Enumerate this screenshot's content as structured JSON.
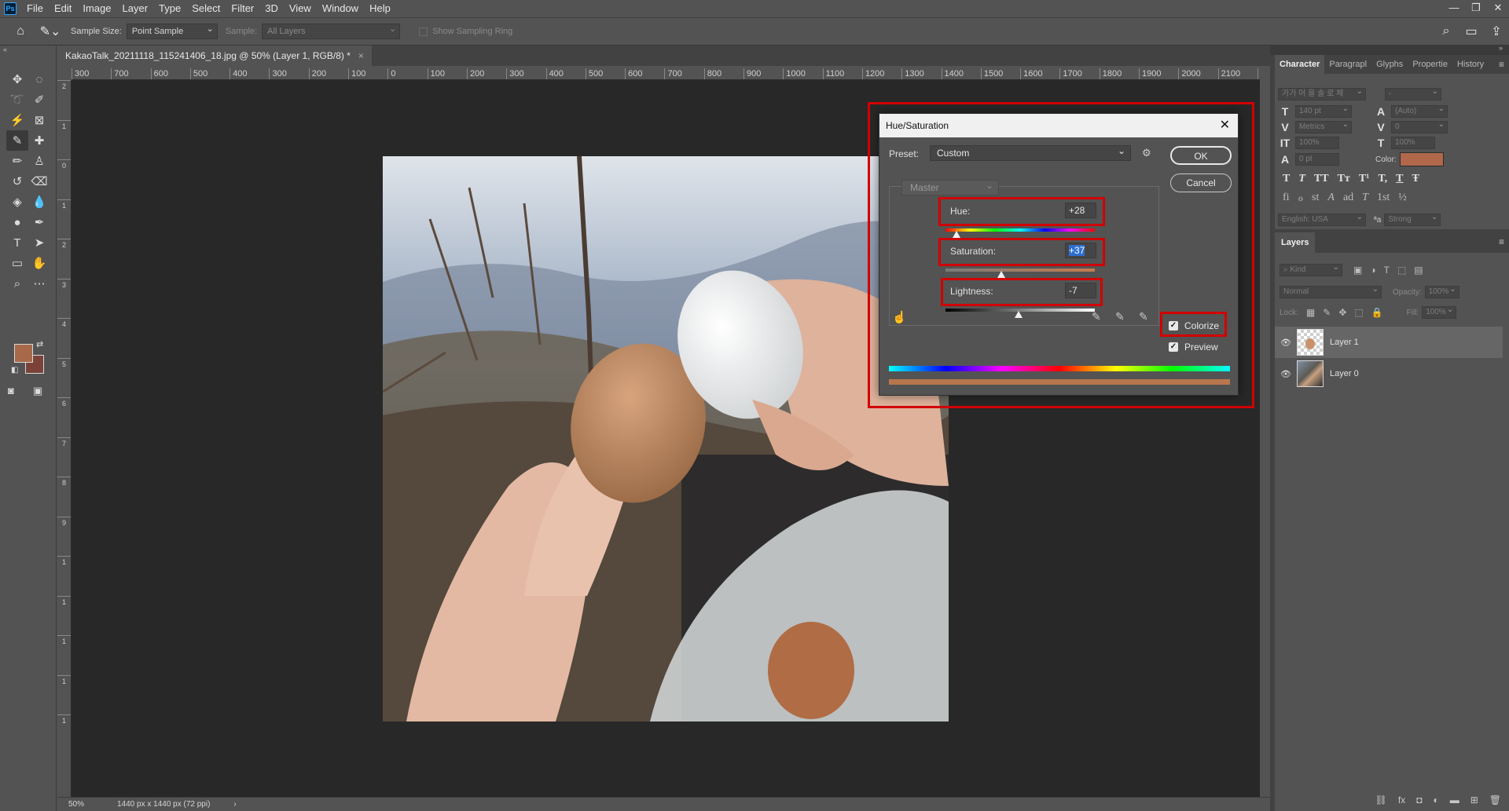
{
  "app": {
    "logo": "Ps",
    "menu": [
      "File",
      "Edit",
      "Image",
      "Layer",
      "Type",
      "Select",
      "Filter",
      "3D",
      "View",
      "Window",
      "Help"
    ],
    "window_controls": [
      "—",
      "❐",
      "✕"
    ]
  },
  "options_bar": {
    "sample_size_label": "Sample Size:",
    "sample_size_value": "Point Sample",
    "sample_label": "Sample:",
    "sample_value": "All Layers",
    "sampling_ring_label": "Show Sampling Ring"
  },
  "document": {
    "tab_title": "KakaoTalk_20211118_115241406_18.jpg @ 50% (Layer 1, RGB/8) *",
    "tab_close": "×",
    "ruler_h": [
      "300",
      "700",
      "600",
      "500",
      "400",
      "300",
      "200",
      "100",
      "0",
      "100",
      "200",
      "300",
      "400",
      "500",
      "600",
      "700",
      "800",
      "900",
      "1000",
      "1100",
      "1200",
      "1300",
      "1400",
      "1500",
      "1600",
      "1700",
      "1800",
      "1900",
      "2000",
      "2100",
      "22"
    ],
    "ruler_v": [
      "2",
      "1",
      "0",
      "1",
      "2",
      "3",
      "4",
      "5",
      "6",
      "7",
      "8",
      "9",
      "1",
      "1",
      "1",
      "1",
      "1"
    ],
    "zoom": "50%",
    "doc_info": "1440 px x 1440 px (72 ppi)",
    "status_arrow": "›"
  },
  "dialog": {
    "title": "Hue/Saturation",
    "close": "✕",
    "preset_label": "Preset:",
    "preset_value": "Custom",
    "ok": "OK",
    "cancel": "Cancel",
    "channel": "Master",
    "hue_label": "Hue:",
    "hue_value": "+28",
    "saturation_label": "Saturation:",
    "saturation_value": "+37",
    "lightness_label": "Lightness:",
    "lightness_value": "-7",
    "colorize_label": "Colorize",
    "colorize_checked": true,
    "preview_label": "Preview",
    "preview_checked": true,
    "highlight_color": "#d20000",
    "colorize_color": "#b9764d"
  },
  "character_panel": {
    "tabs": [
      "Character",
      "Paragrapl",
      "Glyphs",
      "Propertie",
      "History"
    ],
    "font_family": "가가 어 을 솔 로 체",
    "font_style": "-",
    "size": "140 pt",
    "leading": "(Auto)",
    "kerning": "Metrics",
    "tracking": "0",
    "vscale": "100%",
    "hscale": "100%",
    "baseline": "0 pt",
    "color_label": "Color:",
    "color": "#b0674a",
    "language": "English: USA",
    "aa_label": "ªa",
    "antialias": "Strong",
    "style_buttons": [
      "T",
      "T",
      "TT",
      "Tт",
      "T¹",
      "T,",
      "T",
      "Ŧ"
    ],
    "opentype_buttons": [
      "fi",
      "ℴ",
      "st",
      "A",
      "ad",
      "T",
      "1st",
      "½"
    ]
  },
  "layers_panel": {
    "tab": "Layers",
    "kind_label": "Kind",
    "blend_mode": "Normal",
    "opacity_label": "Opacity:",
    "opacity_value": "100%",
    "lock_label": "Lock:",
    "fill_label": "Fill:",
    "fill_value": "100%",
    "layers": [
      {
        "name": "Layer 1",
        "selected": true
      },
      {
        "name": "Layer 0",
        "selected": false
      }
    ]
  }
}
